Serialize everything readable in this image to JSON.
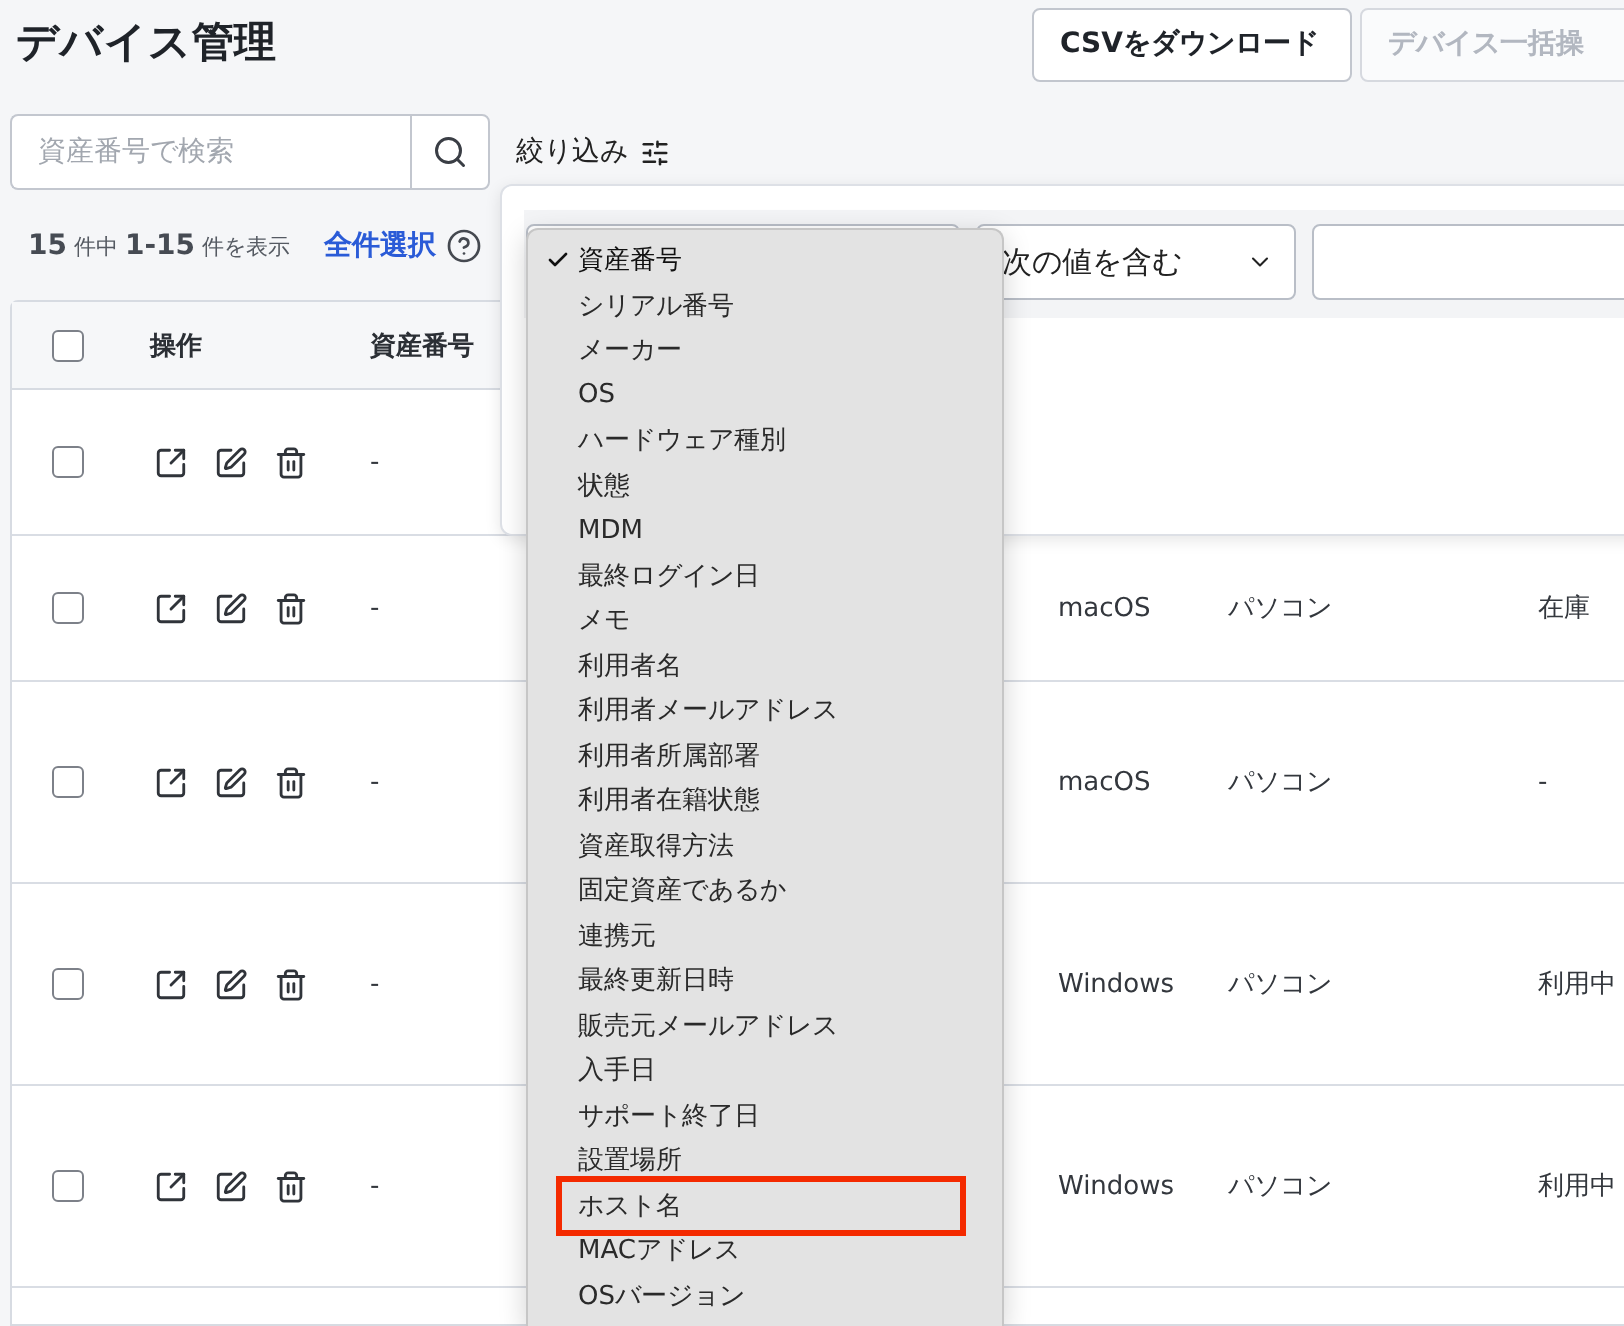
{
  "page": {
    "title": "デバイス管理"
  },
  "header_buttons": [
    {
      "label": "CSVをダウンロード",
      "disabled": false
    },
    {
      "label": "デバイス一括操",
      "disabled": true
    }
  ],
  "search": {
    "placeholder": "資産番号で検索"
  },
  "filter_toggle": {
    "label": "絞り込み"
  },
  "summary": {
    "count": "**15** 件中 **1-15** 件を表示",
    "select_all": "全件選択"
  },
  "table": {
    "header_checked": false,
    "columns": [
      "操作",
      "資産番号"
    ],
    "rows": [
      {
        "checked": false,
        "asset_number": "-"
      },
      {
        "checked": false,
        "asset_number": "-",
        "column_4": "macOS",
        "column_5": "パソコン",
        "column_6": "在庫"
      },
      {
        "checked": false,
        "asset_number": "-",
        "column_4": "macOS",
        "column_5": "パソコン",
        "column_6": "-"
      },
      {
        "checked": false,
        "asset_number": "-",
        "column_4": "Windows",
        "column_5": "パソコン",
        "column_6": "利用中"
      },
      {
        "checked": false,
        "asset_number": "-",
        "column_4": "Windows",
        "column_5": "パソコン",
        "column_6": "利用中"
      }
    ]
  },
  "filter_panel": {
    "operator": "次の値を含む",
    "field_menu": [
      {
        "label": "資産番号",
        "selected": true,
        "highlighted": false
      },
      {
        "label": "シリアル番号",
        "selected": false,
        "highlighted": false
      },
      {
        "label": "メーカー",
        "selected": false,
        "highlighted": false
      },
      {
        "label": "OS",
        "selected": false,
        "highlighted": false
      },
      {
        "label": "ハードウェア種別",
        "selected": false,
        "highlighted": false
      },
      {
        "label": "状態",
        "selected": false,
        "highlighted": false
      },
      {
        "label": "MDM",
        "selected": false,
        "highlighted": false
      },
      {
        "label": "最終ログイン日",
        "selected": false,
        "highlighted": false
      },
      {
        "label": "メモ",
        "selected": false,
        "highlighted": false
      },
      {
        "label": "利用者名",
        "selected": false,
        "highlighted": false
      },
      {
        "label": "利用者メールアドレス",
        "selected": false,
        "highlighted": false
      },
      {
        "label": "利用者所属部署",
        "selected": false,
        "highlighted": false
      },
      {
        "label": "利用者在籍状態",
        "selected": false,
        "highlighted": false
      },
      {
        "label": "資産取得方法",
        "selected": false,
        "highlighted": false
      },
      {
        "label": "固定資産であるか",
        "selected": false,
        "highlighted": false
      },
      {
        "label": "連携元",
        "selected": false,
        "highlighted": false
      },
      {
        "label": "最終更新日時",
        "selected": false,
        "highlighted": false
      },
      {
        "label": "販売元メールアドレス",
        "selected": false,
        "highlighted": false
      },
      {
        "label": "入手日",
        "selected": false,
        "highlighted": false
      },
      {
        "label": "サポート終了日",
        "selected": false,
        "highlighted": false
      },
      {
        "label": "設置場所",
        "selected": false,
        "highlighted": false
      },
      {
        "label": "ホスト名",
        "selected": false,
        "highlighted": true
      },
      {
        "label": "MACアドレス",
        "selected": false,
        "highlighted": false
      },
      {
        "label": "OSバージョン",
        "selected": false,
        "highlighted": false
      }
    ]
  }
}
